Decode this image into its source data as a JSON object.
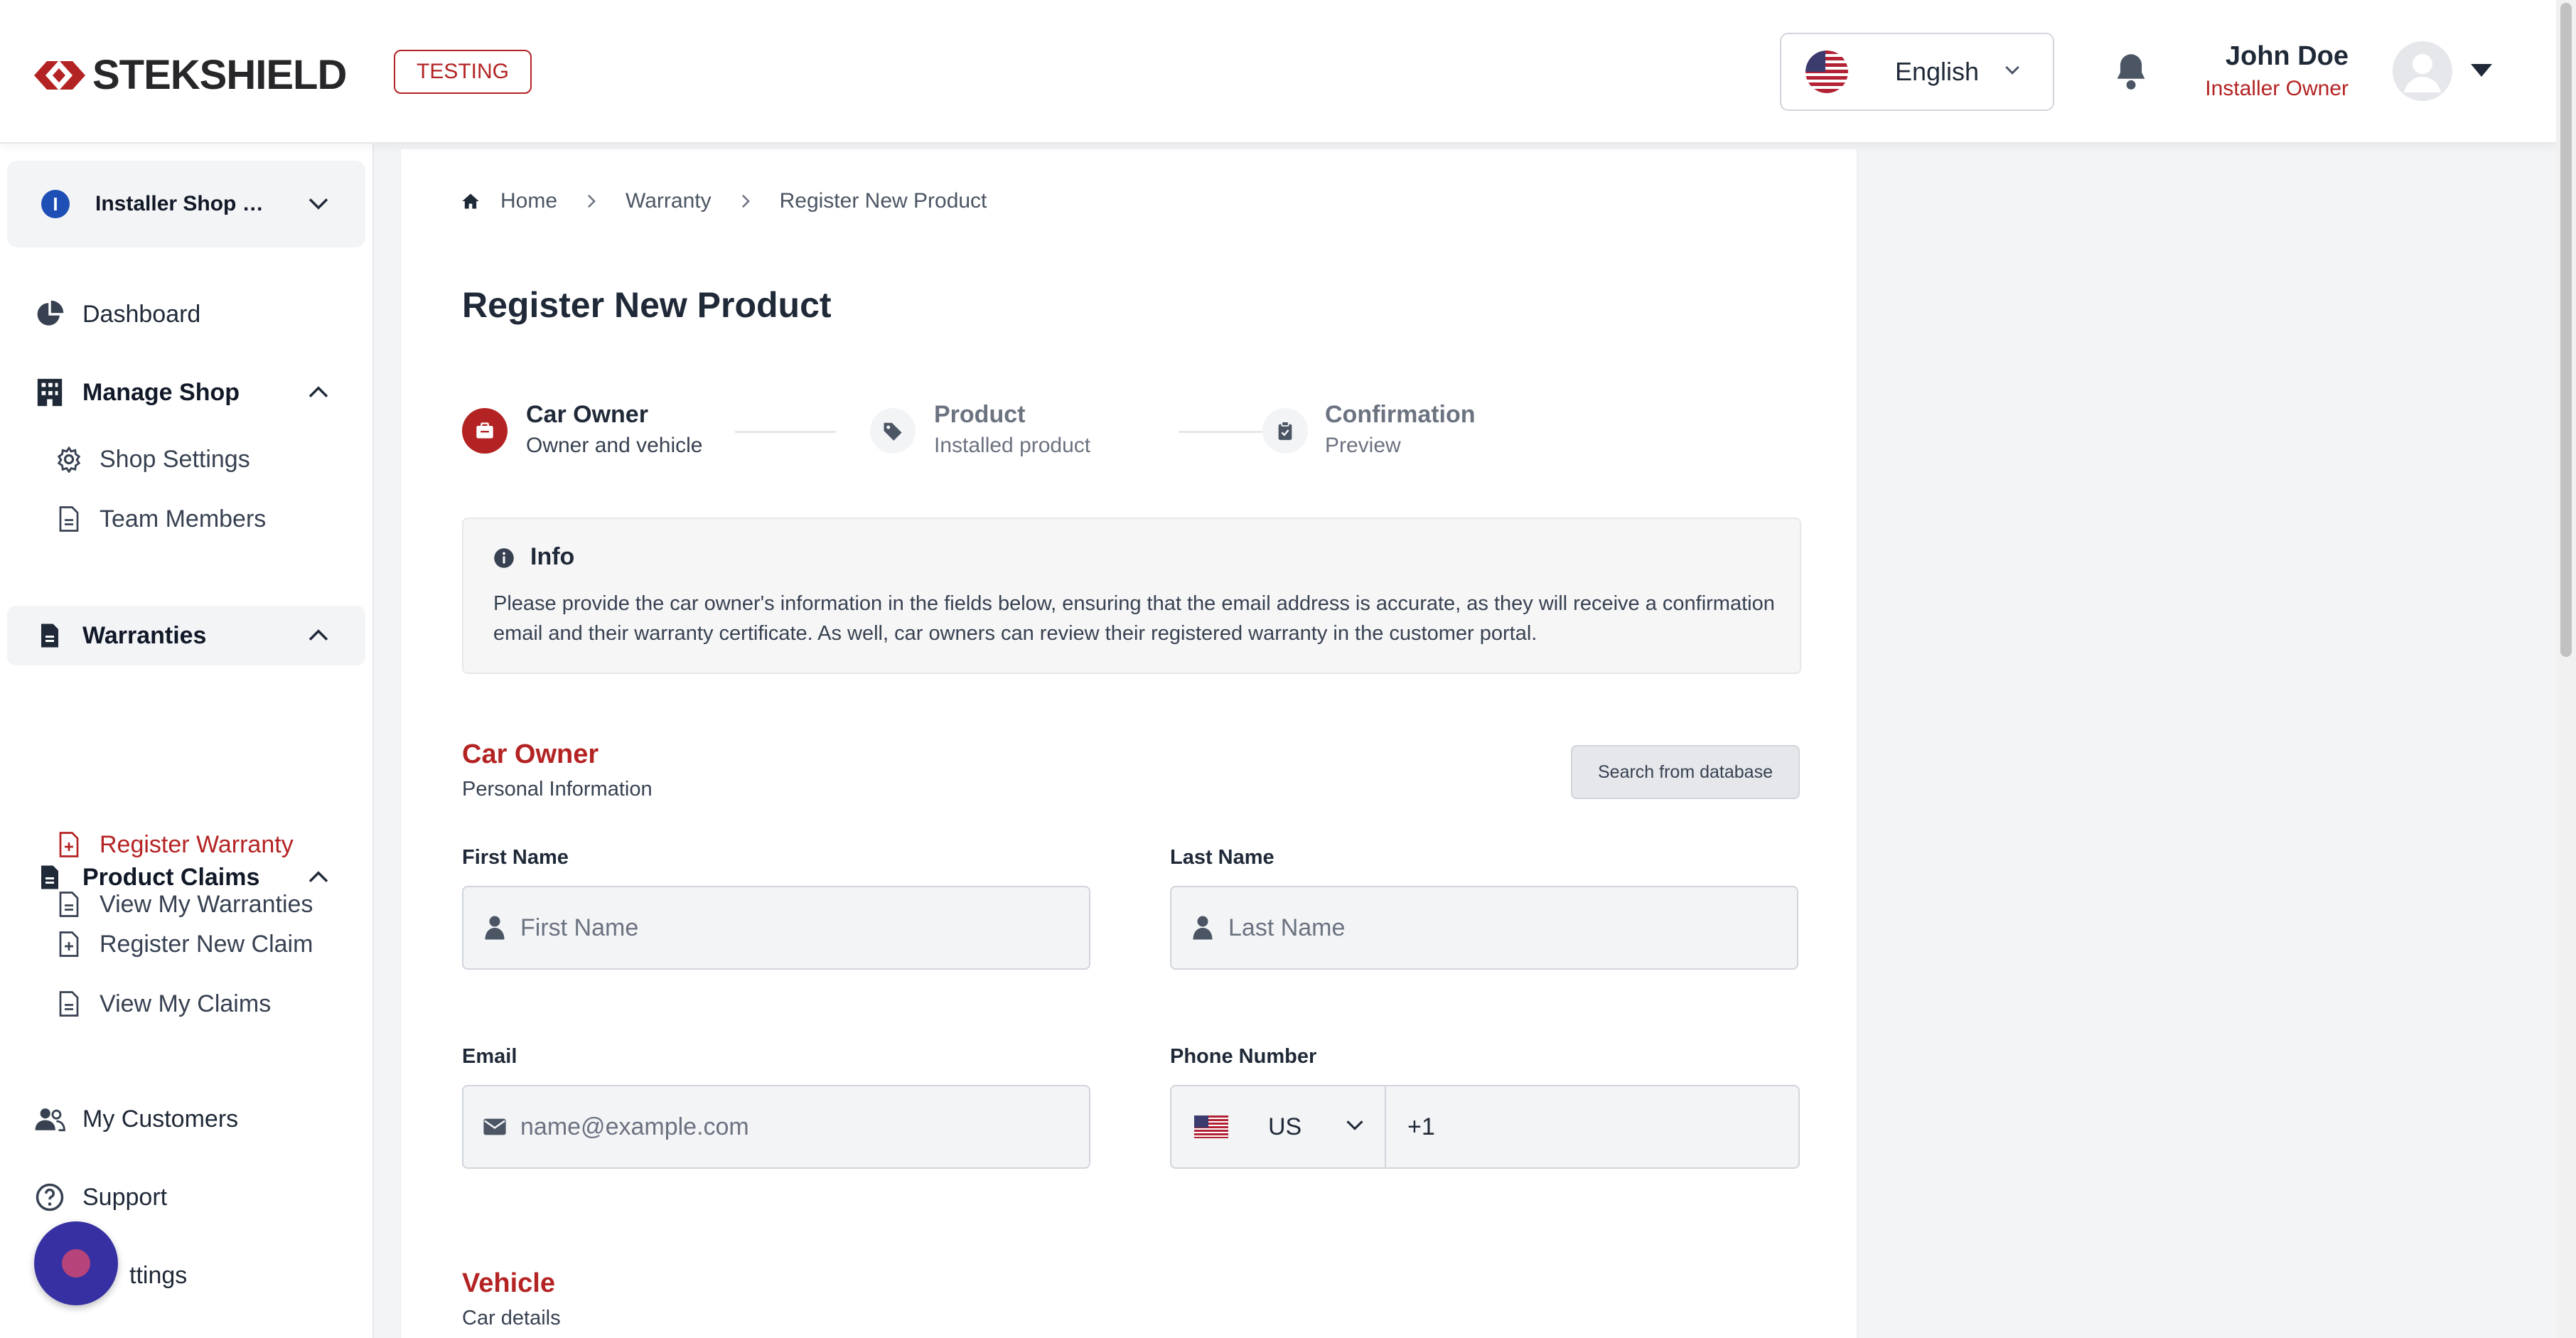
{
  "header": {
    "brand": "STEKSHIELD",
    "env_badge": "TESTING",
    "language": "English",
    "user_name": "John Doe",
    "user_role": "Installer Owner"
  },
  "sidebar": {
    "shop_selector": {
      "initial": "I",
      "label": "Installer Shop M..."
    },
    "items": [
      {
        "label": "Dashboard",
        "icon": "pie-chart-icon"
      },
      {
        "label": "Manage Shop",
        "icon": "building-icon",
        "expanded": true,
        "children": [
          {
            "label": "Shop Settings",
            "icon": "gear-icon"
          },
          {
            "label": "Team Members",
            "icon": "document-icon"
          }
        ]
      },
      {
        "label": "Warranties",
        "icon": "document-icon",
        "expanded": true,
        "children": [
          {
            "label": "Register Warranty",
            "icon": "document-plus-icon",
            "current": true
          },
          {
            "label": "View My Warranties",
            "icon": "document-icon"
          }
        ]
      },
      {
        "label": "Product Claims",
        "icon": "document-icon",
        "expanded": true,
        "children": [
          {
            "label": "Register New Claim",
            "icon": "document-plus-icon"
          },
          {
            "label": "View My Claims",
            "icon": "document-icon"
          }
        ]
      },
      {
        "label": "My Customers",
        "icon": "users-icon"
      },
      {
        "label": "Support",
        "icon": "question-icon"
      },
      {
        "label": "ttings",
        "icon": "gear-icon"
      }
    ]
  },
  "breadcrumb": [
    "Home",
    "Warranty",
    "Register New Product"
  ],
  "page_title": "Register New Product",
  "stepper": [
    {
      "title": "Car Owner",
      "subtitle": "Owner and vehicle",
      "state": "active"
    },
    {
      "title": "Product",
      "subtitle": "Installed product",
      "state": "pending"
    },
    {
      "title": "Confirmation",
      "subtitle": "Preview",
      "state": "pending"
    }
  ],
  "info": {
    "title": "Info",
    "body": "Please provide the car owner's information in the fields below, ensuring that the email address is accurate, as they will receive a confirmation email and their warranty certificate. As well, car owners can review their registered warranty in the customer portal."
  },
  "car_owner": {
    "title": "Car Owner",
    "subtitle": "Personal Information",
    "search_button": "Search from database",
    "first_name": {
      "label": "First Name",
      "placeholder": "First Name",
      "value": ""
    },
    "last_name": {
      "label": "Last Name",
      "placeholder": "Last Name",
      "value": ""
    },
    "email": {
      "label": "Email",
      "placeholder": "name@example.com",
      "value": ""
    },
    "phone": {
      "label": "Phone Number",
      "country": "US",
      "dial_code": "+1"
    }
  },
  "vehicle": {
    "title": "Vehicle",
    "subtitle": "Car details"
  },
  "colors": {
    "accent": "#b42323",
    "brand_dark": "#27272a",
    "fab": "#3730a3"
  }
}
